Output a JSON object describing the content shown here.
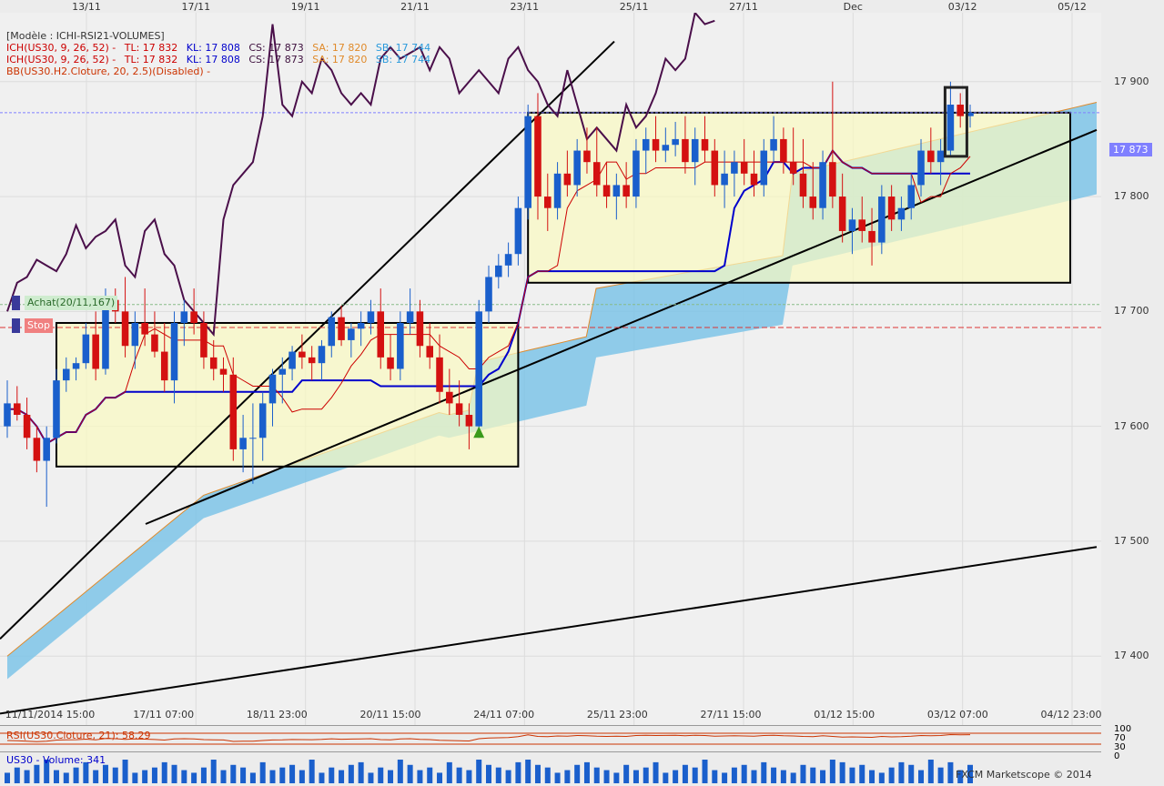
{
  "top_axis": [
    "13/11",
    "17/11",
    "19/11",
    "21/11",
    "23/11",
    "25/11",
    "27/11",
    "Dec",
    "03/12",
    "05/12"
  ],
  "bottom_axis": [
    "11/11/2014 15:00",
    "17/11 07:00",
    "18/11 23:00",
    "20/11 15:00",
    "24/11 07:00",
    "25/11 23:00",
    "27/11 15:00",
    "01/12 15:00",
    "03/12 07:00",
    "04/12 23:00"
  ],
  "legend": {
    "model": "[Modèle : ICHI-RSI21-VOLUMES]",
    "ich_line1": {
      "ich": "ICH(US30, 9, 26, 52) -",
      "tl": "TL: 17 832",
      "kl": "KL: 17 808",
      "cs": "CS: 17 873",
      "sa": "SA: 17 820",
      "sb": "SB: 17 744"
    },
    "ich_line2": {
      "ich": "ICH(US30, 9, 26, 52) -",
      "tl": "TL: 17 832",
      "kl": "KL: 17 808",
      "cs": "CS: 17 873",
      "sa": "SA: 17 820",
      "sb": "SB: 17 744"
    },
    "bb": "BB(US30.H2.Cloture, 20, 2.5)(Disabled) -"
  },
  "orders": {
    "buy": "Achat(20/11,167)",
    "stop": "Stop"
  },
  "current_price": "17 873",
  "rsi_label": "RSI(US30.Cloture, 21): 58.29",
  "rsi_scale": [
    "100",
    "70",
    "30",
    "0"
  ],
  "volume_label": "US30 - Volume: 341",
  "copyright": "FXCM Marketscope © 2014",
  "colors": {
    "bull": "#1a5fcc",
    "bear": "#d41111",
    "cloud": "#7ec4e8",
    "box": "#fafac0",
    "chikou": "#4a0f4a",
    "kijun": "#0000cc",
    "tenkan": "#cc0000",
    "senkou_a": "#e08a2a"
  },
  "chart_data": {
    "type": "candlestick",
    "symbol": "US30",
    "ylim": [
      17340,
      17960
    ],
    "yticks": [
      17400,
      17500,
      17600,
      17700,
      17800,
      17900
    ],
    "levels": {
      "current": 17873,
      "buy": 17706,
      "stop": 17686
    },
    "candles": [
      [
        17600,
        17640,
        17590,
        17620
      ],
      [
        17620,
        17635,
        17605,
        17610
      ],
      [
        17610,
        17625,
        17580,
        17590
      ],
      [
        17590,
        17600,
        17560,
        17570
      ],
      [
        17570,
        17600,
        17530,
        17590
      ],
      [
        17590,
        17650,
        17585,
        17640
      ],
      [
        17640,
        17660,
        17630,
        17650
      ],
      [
        17650,
        17660,
        17640,
        17655
      ],
      [
        17655,
        17690,
        17650,
        17680
      ],
      [
        17680,
        17700,
        17640,
        17650
      ],
      [
        17650,
        17720,
        17645,
        17710
      ],
      [
        17710,
        17720,
        17690,
        17700
      ],
      [
        17700,
        17730,
        17660,
        17670
      ],
      [
        17670,
        17700,
        17650,
        17690
      ],
      [
        17690,
        17720,
        17670,
        17680
      ],
      [
        17680,
        17700,
        17660,
        17665
      ],
      [
        17665,
        17690,
        17630,
        17640
      ],
      [
        17640,
        17700,
        17620,
        17690
      ],
      [
        17690,
        17710,
        17670,
        17700
      ],
      [
        17700,
        17720,
        17680,
        17690
      ],
      [
        17690,
        17700,
        17650,
        17660
      ],
      [
        17660,
        17675,
        17640,
        17650
      ],
      [
        17650,
        17660,
        17630,
        17645
      ],
      [
        17645,
        17660,
        17570,
        17580
      ],
      [
        17580,
        17610,
        17560,
        17590
      ],
      [
        17590,
        17620,
        17550,
        17590
      ],
      [
        17590,
        17630,
        17570,
        17620
      ],
      [
        17620,
        17650,
        17600,
        17645
      ],
      [
        17645,
        17660,
        17620,
        17650
      ],
      [
        17650,
        17670,
        17640,
        17665
      ],
      [
        17665,
        17680,
        17650,
        17660
      ],
      [
        17660,
        17670,
        17640,
        17655
      ],
      [
        17655,
        17675,
        17640,
        17670
      ],
      [
        17670,
        17700,
        17660,
        17695
      ],
      [
        17695,
        17705,
        17670,
        17675
      ],
      [
        17675,
        17690,
        17660,
        17685
      ],
      [
        17685,
        17700,
        17670,
        17690
      ],
      [
        17690,
        17710,
        17680,
        17700
      ],
      [
        17700,
        17720,
        17650,
        17660
      ],
      [
        17660,
        17680,
        17640,
        17650
      ],
      [
        17650,
        17700,
        17640,
        17690
      ],
      [
        17690,
        17720,
        17680,
        17700
      ],
      [
        17700,
        17710,
        17660,
        17670
      ],
      [
        17670,
        17690,
        17650,
        17660
      ],
      [
        17660,
        17680,
        17620,
        17630
      ],
      [
        17630,
        17650,
        17610,
        17620
      ],
      [
        17620,
        17640,
        17600,
        17610
      ],
      [
        17610,
        17620,
        17580,
        17600
      ],
      [
        17600,
        17710,
        17590,
        17700
      ],
      [
        17700,
        17740,
        17690,
        17730
      ],
      [
        17730,
        17750,
        17720,
        17740
      ],
      [
        17740,
        17760,
        17730,
        17750
      ],
      [
        17750,
        17800,
        17740,
        17790
      ],
      [
        17790,
        17880,
        17780,
        17870
      ],
      [
        17870,
        17890,
        17780,
        17800
      ],
      [
        17800,
        17820,
        17770,
        17790
      ],
      [
        17790,
        17830,
        17780,
        17820
      ],
      [
        17820,
        17840,
        17800,
        17810
      ],
      [
        17810,
        17850,
        17800,
        17840
      ],
      [
        17840,
        17860,
        17820,
        17830
      ],
      [
        17830,
        17860,
        17800,
        17810
      ],
      [
        17810,
        17830,
        17790,
        17800
      ],
      [
        17800,
        17820,
        17780,
        17810
      ],
      [
        17810,
        17830,
        17790,
        17800
      ],
      [
        17800,
        17850,
        17790,
        17840
      ],
      [
        17840,
        17860,
        17820,
        17850
      ],
      [
        17850,
        17870,
        17830,
        17840
      ],
      [
        17840,
        17860,
        17830,
        17845
      ],
      [
        17845,
        17865,
        17835,
        17850
      ],
      [
        17850,
        17870,
        17820,
        17830
      ],
      [
        17830,
        17860,
        17810,
        17850
      ],
      [
        17850,
        17870,
        17830,
        17840
      ],
      [
        17840,
        17850,
        17800,
        17810
      ],
      [
        17810,
        17840,
        17790,
        17820
      ],
      [
        17820,
        17840,
        17800,
        17830
      ],
      [
        17830,
        17850,
        17810,
        17820
      ],
      [
        17820,
        17840,
        17800,
        17810
      ],
      [
        17810,
        17850,
        17800,
        17840
      ],
      [
        17840,
        17870,
        17830,
        17850
      ],
      [
        17850,
        17860,
        17820,
        17830
      ],
      [
        17830,
        17860,
        17810,
        17820
      ],
      [
        17820,
        17850,
        17790,
        17800
      ],
      [
        17800,
        17830,
        17780,
        17790
      ],
      [
        17790,
        17840,
        17780,
        17830
      ],
      [
        17830,
        17900,
        17790,
        17800
      ],
      [
        17800,
        17820,
        17760,
        17770
      ],
      [
        17770,
        17790,
        17750,
        17780
      ],
      [
        17780,
        17800,
        17760,
        17770
      ],
      [
        17770,
        17790,
        17740,
        17760
      ],
      [
        17760,
        17810,
        17750,
        17800
      ],
      [
        17800,
        17810,
        17770,
        17780
      ],
      [
        17780,
        17800,
        17770,
        17790
      ],
      [
        17790,
        17820,
        17780,
        17810
      ],
      [
        17810,
        17850,
        17800,
        17840
      ],
      [
        17840,
        17860,
        17820,
        17830
      ],
      [
        17830,
        17850,
        17810,
        17840
      ],
      [
        17840,
        17900,
        17835,
        17880
      ],
      [
        17880,
        17890,
        17860,
        17870
      ],
      [
        17870,
        17880,
        17860,
        17873
      ]
    ],
    "volume": [
      4,
      6,
      5,
      7,
      9,
      5,
      4,
      6,
      8,
      5,
      7,
      6,
      9,
      4,
      5,
      6,
      8,
      7,
      5,
      4,
      6,
      9,
      5,
      7,
      6,
      4,
      8,
      5,
      6,
      7,
      5,
      9,
      4,
      6,
      5,
      7,
      8,
      4,
      6,
      5,
      9,
      7,
      5,
      6,
      4,
      8,
      6,
      5,
      9,
      7,
      6,
      5,
      8,
      9,
      7,
      6,
      4,
      5,
      7,
      8,
      6,
      5,
      4,
      7,
      5,
      6,
      8,
      4,
      5,
      7,
      6,
      9,
      5,
      4,
      6,
      7,
      5,
      8,
      6,
      5,
      4,
      7,
      6,
      5,
      9,
      8,
      6,
      7,
      5,
      4,
      6,
      8,
      7,
      5,
      9,
      6,
      8,
      5,
      7
    ]
  }
}
